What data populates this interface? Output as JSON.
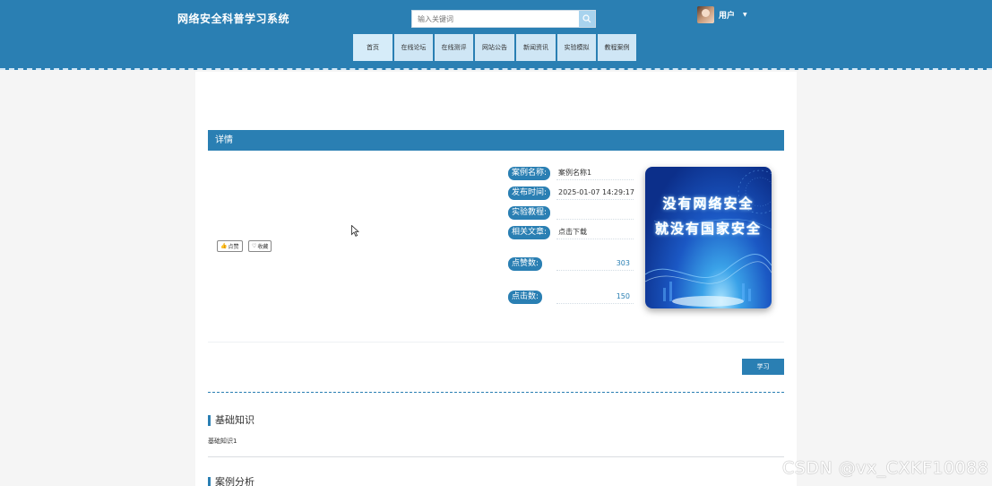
{
  "header": {
    "site_title": "网络安全科普学习系统",
    "search_placeholder": "输入关键词",
    "user_label": "用户",
    "nav": [
      "首页",
      "在线论坛",
      "在线测评",
      "网站公告",
      "新闻资讯",
      "实验模拟",
      "教程案例"
    ]
  },
  "detail": {
    "title": "详情",
    "like_label": "点赞",
    "collect_label": "收藏",
    "fields": {
      "name_label": "案例名称:",
      "name_value": "案例名称1",
      "time_label": "发布时间:",
      "time_value": "2025-01-07 14:29:17",
      "tutorial_label": "实验教程:",
      "tutorial_value": "",
      "article_label": "相关文章:",
      "article_value": "点击下载",
      "likes_label": "点赞数:",
      "likes_value": "303",
      "clicks_label": "点击数:",
      "clicks_value": "150"
    },
    "cover_line1": "没有网络安全",
    "cover_line2": "就没有国家安全",
    "study_label": "学习"
  },
  "sections": [
    {
      "title": "基础知识",
      "text": "基础知识1"
    },
    {
      "title": "案例分析",
      "text": ""
    }
  ],
  "watermark": "CSDN @vx_CXKF10088",
  "colors": {
    "primary": "#2a7fb3",
    "nav_bg": "#cfe6f5"
  }
}
